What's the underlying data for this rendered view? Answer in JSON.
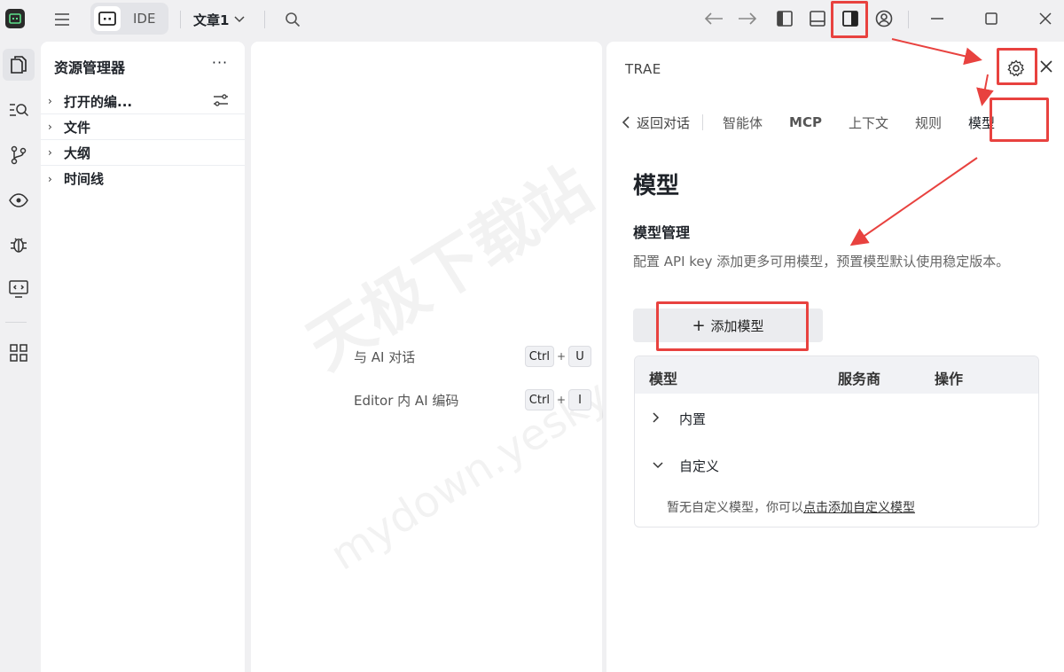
{
  "titlebar": {
    "ide_label": "IDE",
    "doc_title": "文章1"
  },
  "explorer": {
    "title": "资源管理器",
    "more": "···",
    "items": [
      {
        "label": "打开的编..."
      },
      {
        "label": "文件"
      },
      {
        "label": "大纲"
      },
      {
        "label": "时间线"
      }
    ]
  },
  "editor": {
    "shortcuts": [
      {
        "label": "与 AI 对话",
        "key1": "Ctrl",
        "key2": "U"
      },
      {
        "label": "Editor 内 AI 编码",
        "key1": "Ctrl",
        "key2": "I"
      }
    ]
  },
  "panel": {
    "title": "TRAE",
    "back_label": "返回对话",
    "tabs": [
      "智能体",
      "MCP",
      "上下文",
      "规则",
      "模型"
    ],
    "heading": "模型",
    "section_title": "模型管理",
    "description": "配置 API key 添加更多可用模型，预置模型默认使用稳定版本。",
    "add_button": "添加模型",
    "table": {
      "col_model": "模型",
      "col_provider": "服务商",
      "col_action": "操作",
      "rows": [
        {
          "label": "内置",
          "expanded": false
        },
        {
          "label": "自定义",
          "expanded": true
        }
      ],
      "empty_prefix": "暂无自定义模型，你可以",
      "empty_link": "点击添加自定义模型"
    }
  },
  "watermark": {
    "cn": "天极下载站",
    "en": "mydown.yesky.com"
  },
  "colors": {
    "highlight": "#e8423f",
    "panel_bg": "#ffffff",
    "app_bg": "#f0f0f2"
  }
}
